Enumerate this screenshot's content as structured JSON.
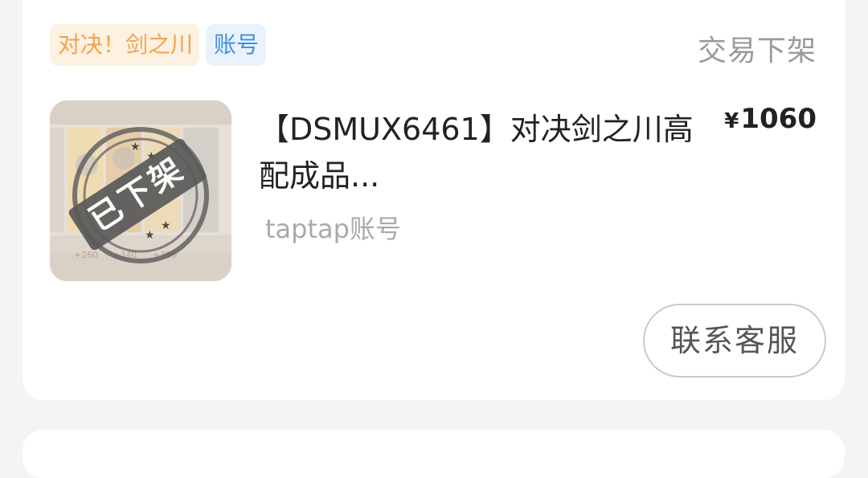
{
  "order": {
    "tags": {
      "game": "对决！剑之川",
      "type": "账号"
    },
    "status": "交易下架",
    "thumbnail": {
      "stamp_text": "已下架",
      "values": [
        "+260",
        "+340",
        "+300"
      ]
    },
    "title": "【DSMUX6461】对决剑之川高配成品...",
    "price": {
      "symbol": "¥",
      "amount": "1060"
    },
    "subtitle": "taptap账号",
    "contact_button": "联系客服"
  },
  "colors": {
    "game_tag_text": "#f3a34a",
    "game_tag_bg": "#fdf1e2",
    "type_tag_text": "#3f8ee0",
    "type_tag_bg": "#eaf3fd",
    "status_text": "#9a9a9a"
  }
}
